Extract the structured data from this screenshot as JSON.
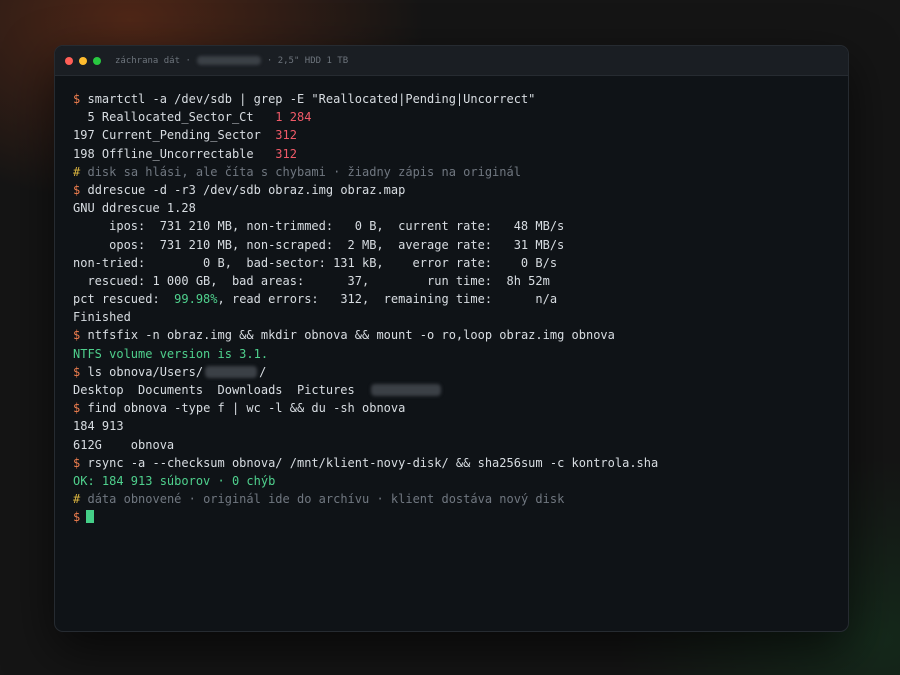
{
  "window": {
    "title_prefix": "záchrana dát ·",
    "title_suffix": "· 2,5\" HDD 1 TB"
  },
  "colors": {
    "prompt": "#f07f4f",
    "comment_mark": "#d9b33f",
    "error_value": "#f05a68",
    "success": "#4fd08d",
    "cursor": "#45cf88"
  },
  "terminal": {
    "prompt_symbol": "$",
    "comment_symbol": "#",
    "cmd1": "smartctl -a /dev/sdb | grep -E \"Reallocated|Pending|Uncorrect\"",
    "smart1_label": "  5 Reallocated_Sector_Ct   ",
    "smart1_value": "1 284",
    "smart2_label": "197 Current_Pending_Sector  ",
    "smart2_value": "312",
    "smart3_label": "198 Offline_Uncorrectable   ",
    "smart3_value": "312",
    "comment1": "disk sa hlási, ale číta s chybami · žiadny zápis na originál",
    "cmd2": "ddrescue -d -r3 /dev/sdb obraz.img obraz.map",
    "dd1": "GNU ddrescue 1.28",
    "dd2": "     ipos:  731 210 MB, non-trimmed:   0 B,  current rate:   48 MB/s",
    "dd3": "     opos:  731 210 MB, non-scraped:  2 MB,  average rate:   31 MB/s",
    "dd4": "non-tried:        0 B,  bad-sector: 131 kB,    error rate:    0 B/s",
    "dd5": "  rescued: 1 000 GB,  bad areas:      37,        run time:  8h 52m",
    "dd6_a": "pct rescued:  ",
    "dd6_pct": "99.98%",
    "dd6_b": ", read errors:   312,  remaining time:      n/a",
    "dd7": "Finished",
    "cmd3": "ntfsfix -n obraz.img && mkdir obnova && mount -o ro,loop obraz.img obnova",
    "ntfs_out": "NTFS volume version is 3.1.",
    "cmd4_a": "ls obnova/Users/",
    "cmd4_b": "/",
    "ls_out": "Desktop  Documents  Downloads  Pictures  ",
    "cmd5": "find obnova -type f | wc -l && du -sh obnova",
    "find_out": "184 913",
    "du_out": "612G    obnova",
    "cmd6": "rsync -a --checksum obnova/ /mnt/klient-novy-disk/ && sha256sum -c kontrola.sha",
    "sha_out": "OK: 184 913 súborov · 0 chýb",
    "comment2": "dáta obnovené · originál ide do archívu · klient dostáva nový disk"
  }
}
